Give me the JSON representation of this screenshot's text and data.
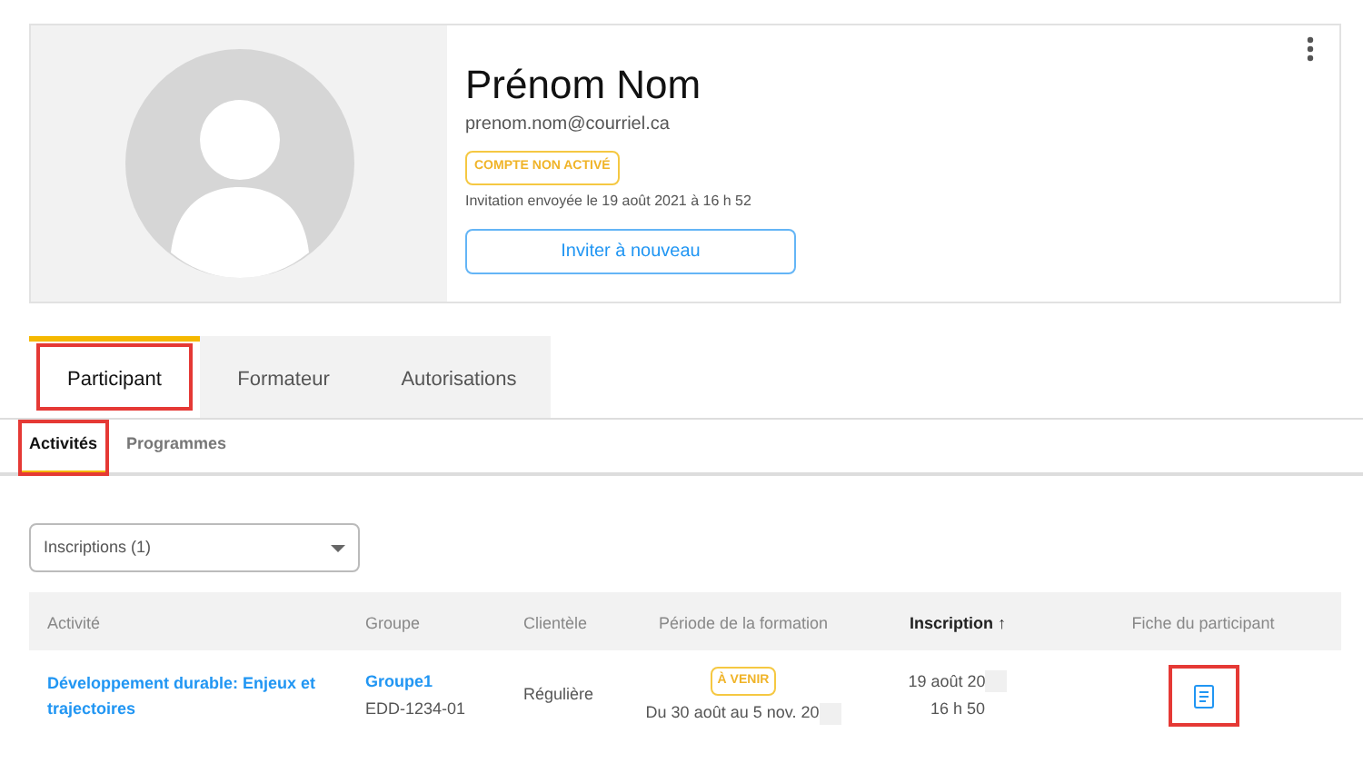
{
  "profile": {
    "name": "Prénom Nom",
    "email": "prenom.nom@courriel.ca",
    "badge": "COMPTE NON ACTIVÉ",
    "invitation": "Invitation envoyée le 19 août 2021 à 16 h 52",
    "button": "Inviter à nouveau"
  },
  "tabs": [
    {
      "label": "Participant",
      "selected": true,
      "highlighted": true
    },
    {
      "label": "Formateur",
      "selected": false,
      "highlighted": false
    },
    {
      "label": "Autorisations",
      "selected": false,
      "highlighted": false
    }
  ],
  "subtabs": [
    {
      "label": "Activités",
      "selected": true,
      "highlighted": true
    },
    {
      "label": "Programmes",
      "selected": false,
      "highlighted": false
    }
  ],
  "filter": {
    "value": "Inscriptions (1)"
  },
  "table": {
    "columns": [
      {
        "label": "Activité",
        "sorted": false
      },
      {
        "label": "Groupe",
        "sorted": false
      },
      {
        "label": "Clientèle",
        "sorted": false
      },
      {
        "label": "Période de la formation",
        "sorted": false
      },
      {
        "label": "Inscription ↑",
        "sorted": true
      },
      {
        "label": "Fiche du participant",
        "sorted": false
      }
    ],
    "rows": [
      {
        "activity": "Développement durable: Enjeux et trajectoires",
        "group": "Groupe1",
        "group_code": "EDD-1234-01",
        "clientele": "Régulière",
        "status": "À VENIR",
        "period": "Du 30 août au 5 nov. 20",
        "date": "19 août 20",
        "time": "16 h 50",
        "sheet_highlighted": true
      }
    ]
  }
}
